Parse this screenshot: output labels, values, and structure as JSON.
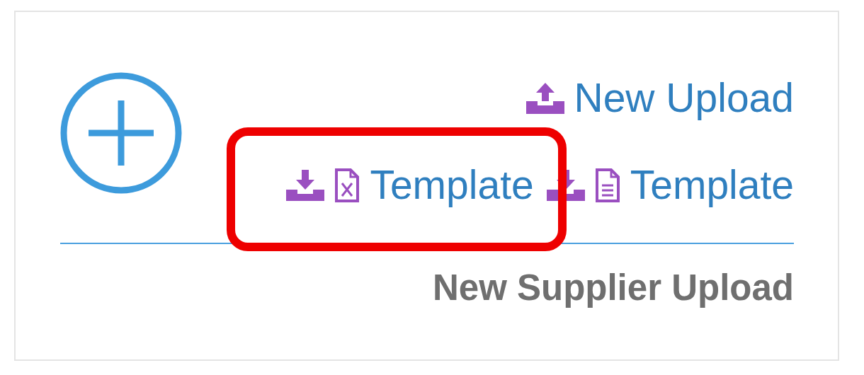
{
  "card": {
    "add_button": {
      "kind": "circle-plus"
    },
    "links": [
      {
        "label": "New Upload",
        "kind": "upload"
      },
      {
        "label": "Template",
        "kind": "excel-template"
      },
      {
        "label": "Template",
        "kind": "doc-template"
      }
    ],
    "caption": "New Supplier Upload"
  },
  "annotation": {
    "kind": "rounded-rectangle",
    "color": "#ee0000"
  }
}
